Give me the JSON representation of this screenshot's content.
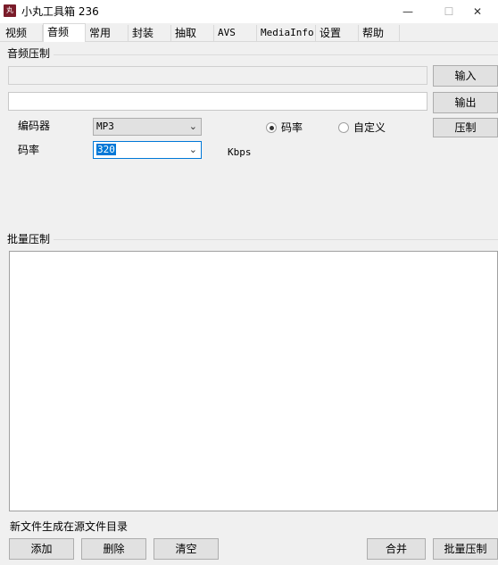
{
  "window": {
    "title": "小丸工具箱 236",
    "icon_glyph": "丸",
    "minimize": "—",
    "maximize": "☐",
    "close": "✕"
  },
  "tabs": [
    "视频",
    "音频",
    "常用",
    "封装",
    "抽取",
    "AVS",
    "MediaInfo",
    "设置",
    "帮助"
  ],
  "active_tab": "音频",
  "audio_section": {
    "title": "音频压制",
    "input_button": "输入",
    "output_button": "输出",
    "encode_button": "压制",
    "encoder_label": "编码器",
    "encoder_value": "MP3",
    "bitrate_label": "码率",
    "bitrate_value": "320",
    "bitrate_unit": "Kbps",
    "radio_bitrate": "码率",
    "radio_custom": "自定义",
    "selected_radio": "码率"
  },
  "batch_section": {
    "title": "批量压制",
    "output_note": "新文件生成在源文件目录",
    "add_button": "添加",
    "delete_button": "删除",
    "clear_button": "清空",
    "merge_button": "合并",
    "batch_button": "批量压制"
  },
  "icons": {
    "dropdown": "chevron-down-icon"
  }
}
